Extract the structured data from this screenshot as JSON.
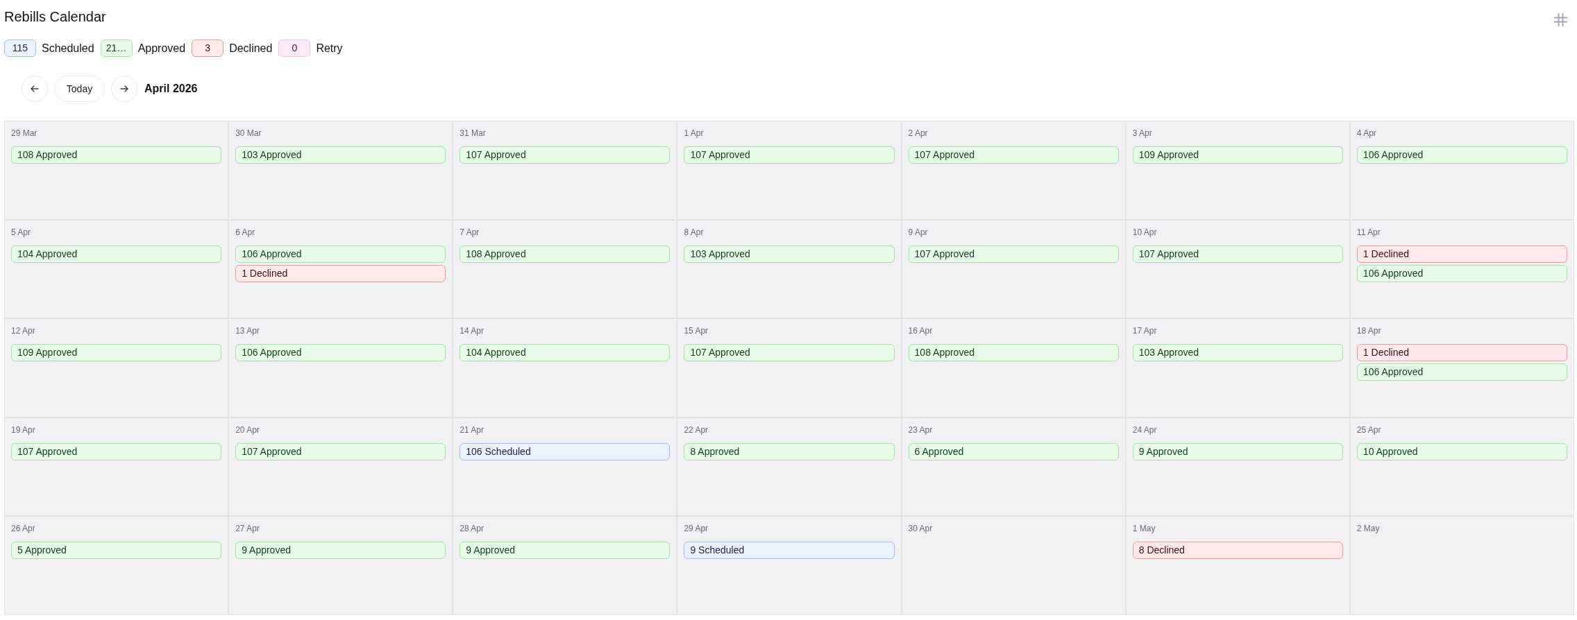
{
  "header": {
    "title": "Rebills Calendar"
  },
  "legend": [
    {
      "count": "115",
      "label": "Scheduled",
      "kind": "scheduled"
    },
    {
      "count": "21…",
      "label": "Approved",
      "kind": "approved"
    },
    {
      "count": "3",
      "label": "Declined",
      "kind": "declined"
    },
    {
      "count": "0",
      "label": "Retry",
      "kind": "retry"
    }
  ],
  "nav": {
    "today": "Today",
    "month": "April 2026"
  },
  "calendar": {
    "weeks": [
      {
        "days": [
          {
            "date": "29 Mar",
            "events": [
              {
                "text": "108 Approved",
                "kind": "approved"
              }
            ]
          },
          {
            "date": "30 Mar",
            "events": [
              {
                "text": "103 Approved",
                "kind": "approved"
              }
            ]
          },
          {
            "date": "31 Mar",
            "events": [
              {
                "text": "107 Approved",
                "kind": "approved"
              }
            ]
          },
          {
            "date": "1 Apr",
            "events": [
              {
                "text": "107 Approved",
                "kind": "approved"
              }
            ]
          },
          {
            "date": "2 Apr",
            "events": [
              {
                "text": "107 Approved",
                "kind": "approved"
              }
            ]
          },
          {
            "date": "3 Apr",
            "events": [
              {
                "text": "109 Approved",
                "kind": "approved"
              }
            ]
          },
          {
            "date": "4 Apr",
            "events": [
              {
                "text": "106 Approved",
                "kind": "approved"
              }
            ]
          }
        ]
      },
      {
        "days": [
          {
            "date": "5 Apr",
            "events": [
              {
                "text": "104 Approved",
                "kind": "approved"
              }
            ]
          },
          {
            "date": "6 Apr",
            "events": [
              {
                "text": "106 Approved",
                "kind": "approved"
              },
              {
                "text": "1 Declined",
                "kind": "declined"
              }
            ]
          },
          {
            "date": "7 Apr",
            "events": [
              {
                "text": "108 Approved",
                "kind": "approved"
              }
            ]
          },
          {
            "date": "8 Apr",
            "events": [
              {
                "text": "103 Approved",
                "kind": "approved"
              }
            ]
          },
          {
            "date": "9 Apr",
            "events": [
              {
                "text": "107 Approved",
                "kind": "approved"
              }
            ]
          },
          {
            "date": "10 Apr",
            "events": [
              {
                "text": "107 Approved",
                "kind": "approved"
              }
            ]
          },
          {
            "date": "11 Apr",
            "events": [
              {
                "text": "1 Declined",
                "kind": "declined"
              },
              {
                "text": "106 Approved",
                "kind": "approved"
              }
            ]
          }
        ]
      },
      {
        "days": [
          {
            "date": "12 Apr",
            "events": [
              {
                "text": "109 Approved",
                "kind": "approved"
              }
            ]
          },
          {
            "date": "13 Apr",
            "events": [
              {
                "text": "106 Approved",
                "kind": "approved"
              }
            ]
          },
          {
            "date": "14 Apr",
            "events": [
              {
                "text": "104 Approved",
                "kind": "approved"
              }
            ]
          },
          {
            "date": "15 Apr",
            "events": [
              {
                "text": "107 Approved",
                "kind": "approved"
              }
            ]
          },
          {
            "date": "16 Apr",
            "events": [
              {
                "text": "108 Approved",
                "kind": "approved"
              }
            ]
          },
          {
            "date": "17 Apr",
            "events": [
              {
                "text": "103 Approved",
                "kind": "approved"
              }
            ]
          },
          {
            "date": "18 Apr",
            "events": [
              {
                "text": "1 Declined",
                "kind": "declined"
              },
              {
                "text": "106 Approved",
                "kind": "approved"
              }
            ]
          }
        ]
      },
      {
        "days": [
          {
            "date": "19 Apr",
            "events": [
              {
                "text": "107 Approved",
                "kind": "approved"
              }
            ]
          },
          {
            "date": "20 Apr",
            "events": [
              {
                "text": "107 Approved",
                "kind": "approved"
              }
            ]
          },
          {
            "date": "21 Apr",
            "events": [
              {
                "text": "106 Scheduled",
                "kind": "scheduled"
              }
            ]
          },
          {
            "date": "22 Apr",
            "events": [
              {
                "text": "8 Approved",
                "kind": "approved"
              }
            ]
          },
          {
            "date": "23 Apr",
            "events": [
              {
                "text": "6 Approved",
                "kind": "approved"
              }
            ]
          },
          {
            "date": "24 Apr",
            "events": [
              {
                "text": "9 Approved",
                "kind": "approved"
              }
            ]
          },
          {
            "date": "25 Apr",
            "events": [
              {
                "text": "10 Approved",
                "kind": "approved"
              }
            ]
          }
        ]
      },
      {
        "days": [
          {
            "date": "26 Apr",
            "events": [
              {
                "text": "5 Approved",
                "kind": "approved"
              }
            ]
          },
          {
            "date": "27 Apr",
            "events": [
              {
                "text": "9 Approved",
                "kind": "approved"
              }
            ]
          },
          {
            "date": "28 Apr",
            "events": [
              {
                "text": "9 Approved",
                "kind": "approved"
              }
            ]
          },
          {
            "date": "29 Apr",
            "events": [
              {
                "text": "9 Scheduled",
                "kind": "scheduled"
              }
            ]
          },
          {
            "date": "30 Apr"
          },
          {
            "date": "1 May",
            "events": [
              {
                "text": "8 Declined",
                "kind": "declined"
              }
            ]
          },
          {
            "date": "2 May"
          }
        ]
      }
    ]
  }
}
